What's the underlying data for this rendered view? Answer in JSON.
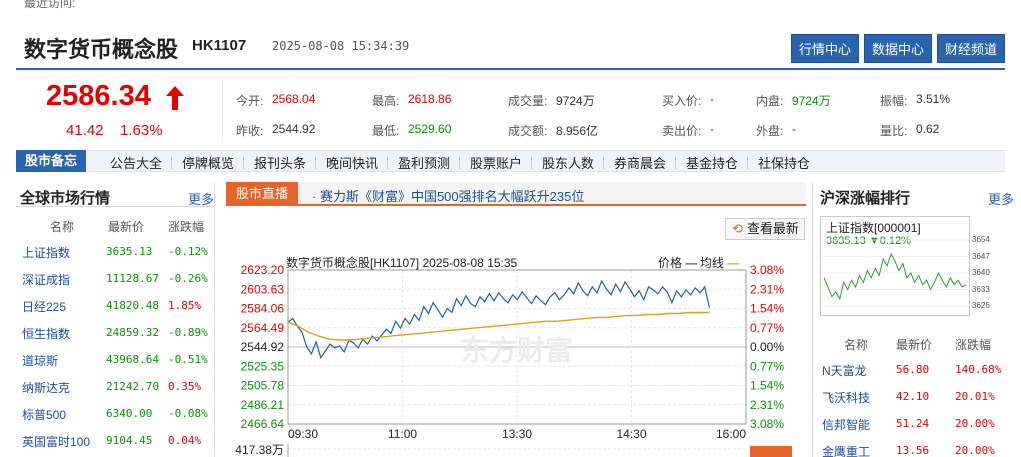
{
  "header": {
    "recent_label": "最近访问:",
    "title": "数字货币概念股",
    "code": "HK1107",
    "timestamp": "2025-08-08 15:34:39",
    "buttons": [
      "行情中心",
      "数据中心",
      "财经频道"
    ]
  },
  "quote": {
    "price": "2586.34",
    "change": "41.42",
    "change_pct": "1.63%",
    "up_color": "#e40000",
    "fields": [
      {
        "label": "今开:",
        "value": "2568.04",
        "tone": "red"
      },
      {
        "label": "最高:",
        "value": "2618.86",
        "tone": "red"
      },
      {
        "label": "成交量:",
        "value": "9724万",
        "tone": "black"
      },
      {
        "label": "买入价:",
        "value": "-",
        "tone": "black"
      },
      {
        "label": "内盘:",
        "value": "9724万",
        "tone": "green"
      },
      {
        "label": "振幅:",
        "value": "3.51%",
        "tone": "black"
      },
      {
        "label": "昨收:",
        "value": "2544.92",
        "tone": "black"
      },
      {
        "label": "最低:",
        "value": "2529.60",
        "tone": "green"
      },
      {
        "label": "成交额:",
        "value": "8.956亿",
        "tone": "black"
      },
      {
        "label": "卖出价:",
        "value": "-",
        "tone": "black"
      },
      {
        "label": "外盘:",
        "value": "-",
        "tone": "black"
      },
      {
        "label": "量比:",
        "value": "0.62",
        "tone": "black"
      }
    ]
  },
  "nav": {
    "tag": "股市备忘",
    "items": [
      "公告大全",
      "停牌概览",
      "报刊头条",
      "晚间快讯",
      "盈利预测",
      "股票账户",
      "股东人数",
      "券商晨会",
      "基金持仓",
      "社保持仓"
    ]
  },
  "global_market": {
    "title": "全球市场行情",
    "more": "更多",
    "headers": [
      "名称",
      "最新价",
      "涨跌幅"
    ],
    "rows": [
      {
        "name": "上证指数",
        "price": "3635.13",
        "pct": "-0.12%",
        "tone": "green"
      },
      {
        "name": "深证成指",
        "price": "11128.67",
        "pct": "-0.26%",
        "tone": "green"
      },
      {
        "name": "日经225",
        "price": "41820.48",
        "pct": "1.85%",
        "tone": "red"
      },
      {
        "name": "恒生指数",
        "price": "24859.32",
        "pct": "-0.89%",
        "tone": "green"
      },
      {
        "name": "道琼斯",
        "price": "43968.64",
        "pct": "-0.51%",
        "tone": "green"
      },
      {
        "name": "纳斯达克",
        "price": "21242.70",
        "pct": "0.35%",
        "tone": "red"
      },
      {
        "name": "标普500",
        "price": "6340.00",
        "pct": "-0.08%",
        "tone": "green"
      },
      {
        "name": "英国富时100",
        "price": "9104.45",
        "pct": "0.04%",
        "tone": "red"
      }
    ]
  },
  "live": {
    "tag": "股市直播",
    "headline": "· 赛力斯《财富》中国500强排名大幅跃升235位",
    "refresh_label": "查看最新"
  },
  "chart_data": {
    "type": "line",
    "title": "数字货币概念股[HK1107] 2025-08-08 15:35",
    "legend": [
      "价格",
      "均线"
    ],
    "y_ticks": [
      "2623.20",
      "2603.63",
      "2584.06",
      "2564.49",
      "2544.92",
      "2525.35",
      "2505.78",
      "2486.21",
      "2466.64"
    ],
    "pct_ticks": [
      "3.08%",
      "2.31%",
      "1.54%",
      "0.77%",
      "0.00%",
      "0.77%",
      "1.54%",
      "2.31%",
      "3.08%"
    ],
    "x_ticks": [
      "09:30",
      "11:00",
      "13:30",
      "14:30",
      "16:00"
    ],
    "ylim": [
      2466.64,
      2623.2
    ],
    "volume_label": "417.38万",
    "watermark": "东方财富",
    "price_color": "#1f5fa8",
    "avg_color": "#d9a21b",
    "series": [
      {
        "name": "价格",
        "values": [
          2570,
          2574,
          2566,
          2560,
          2545,
          2538,
          2550,
          2534,
          2541,
          2548,
          2544,
          2546,
          2540,
          2552,
          2549,
          2544,
          2553,
          2548,
          2556,
          2551,
          2557,
          2563,
          2559,
          2571,
          2564,
          2574,
          2568,
          2578,
          2572,
          2586,
          2579,
          2590,
          2583,
          2575,
          2584,
          2580,
          2594,
          2587,
          2597,
          2589,
          2586,
          2596,
          2591,
          2599,
          2592,
          2600,
          2594,
          2590,
          2598,
          2593,
          2601,
          2595,
          2589,
          2597,
          2592,
          2588,
          2596,
          2600,
          2593,
          2598,
          2605,
          2599,
          2610,
          2602,
          2597,
          2606,
          2600,
          2612,
          2604,
          2598,
          2609,
          2601,
          2611,
          2604,
          2596,
          2602,
          2593,
          2606,
          2603,
          2599,
          2606,
          2601,
          2590,
          2602,
          2596,
          2603,
          2598,
          2605,
          2600,
          2606,
          2585
        ]
      },
      {
        "name": "均线",
        "values": [
          2570,
          2566,
          2560,
          2556,
          2553,
          2552,
          2552,
          2553,
          2554,
          2555,
          2556,
          2557,
          2558,
          2559,
          2560,
          2561,
          2562,
          2563,
          2564,
          2565,
          2566,
          2567,
          2568,
          2569,
          2570,
          2571,
          2571,
          2572,
          2573,
          2574,
          2575,
          2575,
          2576,
          2577,
          2577,
          2578,
          2578,
          2579,
          2579,
          2580,
          2580,
          2580
        ]
      }
    ]
  },
  "right_panel": {
    "title": "沪深涨幅排行",
    "more": "更多",
    "mini_title": "上证指数[000001]",
    "mini_value": "3635.13 ▼0.12%",
    "mini_y": [
      "3654",
      "3647",
      "3640",
      "3633",
      "3626"
    ],
    "mini_ylim": [
      3626,
      3654
    ],
    "mini_values": [
      3638,
      3634,
      3630,
      3632,
      3629,
      3636,
      3633,
      3637,
      3634,
      3639,
      3636,
      3641,
      3638,
      3642,
      3639,
      3646,
      3643,
      3648,
      3645,
      3641,
      3644,
      3638,
      3640,
      3636,
      3639,
      3635,
      3637,
      3633,
      3636,
      3640,
      3637,
      3634,
      3638,
      3635,
      3637,
      3634,
      3635
    ],
    "headers": [
      "名称",
      "最新价",
      "涨跌幅"
    ],
    "rows": [
      {
        "name": "N天富龙",
        "price": "56.80",
        "pct": "140.68%"
      },
      {
        "name": "飞沃科技",
        "price": "42.10",
        "pct": "20.01%"
      },
      {
        "name": "信邦智能",
        "price": "51.24",
        "pct": "20.00%"
      },
      {
        "name": "金鹰重工",
        "price": "13.56",
        "pct": "20.00%"
      }
    ]
  }
}
